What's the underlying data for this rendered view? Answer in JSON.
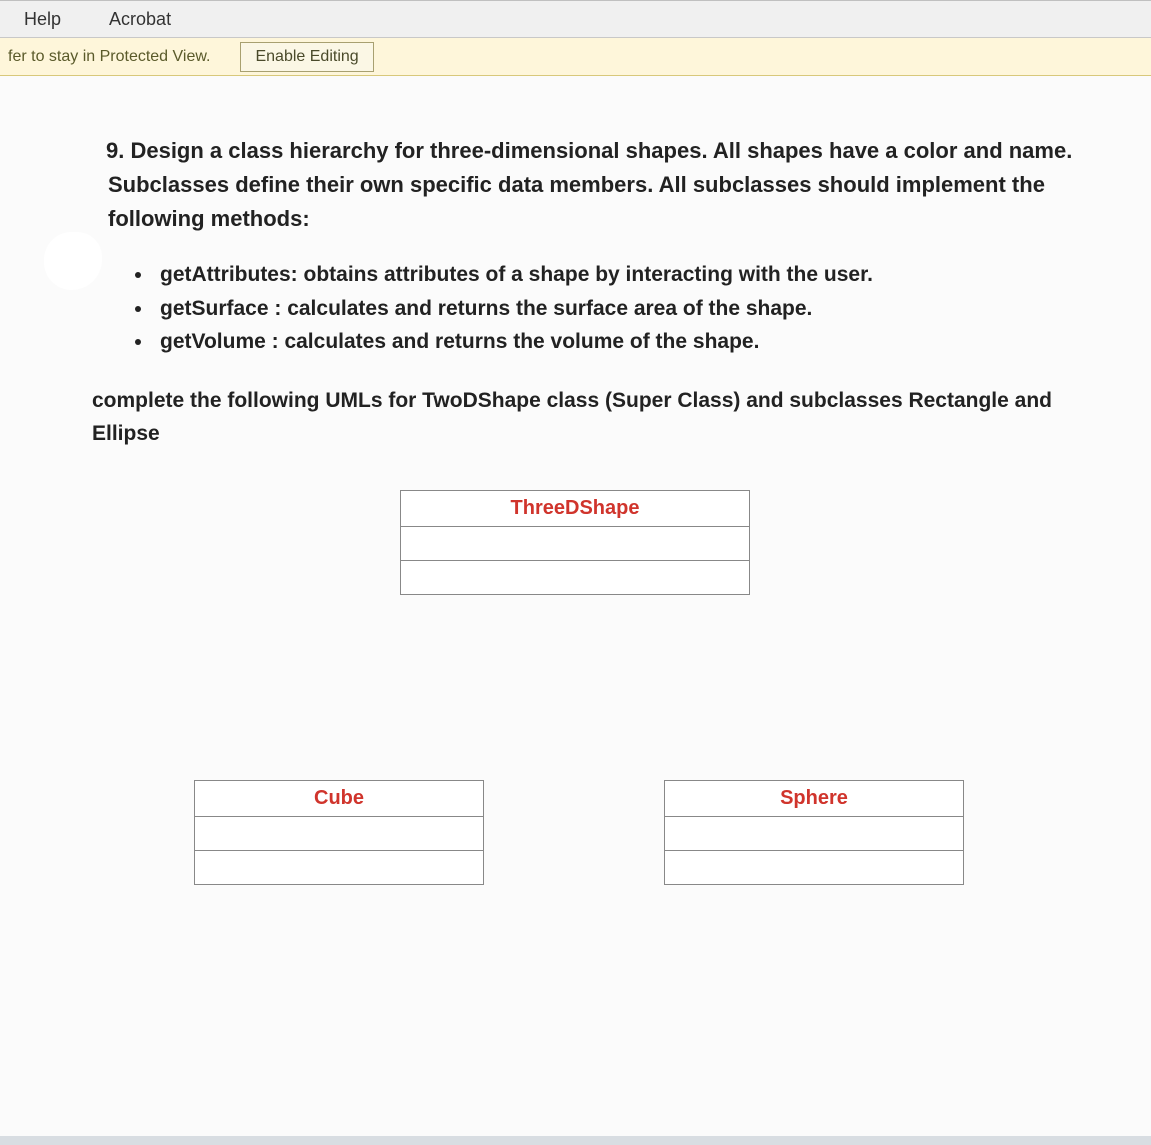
{
  "topbar": {
    "help": "Help",
    "acrobat": "Acrobat"
  },
  "warning": {
    "message": "fer to stay in Protected View.",
    "button": "Enable Editing"
  },
  "question": {
    "number_and_text": "9. Design a class hierarchy for three-dimensional shapes. All shapes have a color and name.  Subclasses define their own specific data members.  All subclasses should implement the following methods:"
  },
  "bullets": [
    "getAttributes: obtains attributes of a shape by interacting with the user.",
    "getSurface    : calculates and returns the surface area of the shape.",
    "getVolume  : calculates and returns the volume of the shape."
  ],
  "complete": "complete the following UMLs for TwoDShape class (Super Class) and subclasses Rectangle and Ellipse",
  "uml": {
    "parent": "ThreeDShape",
    "left": "Cube",
    "right": "Sphere"
  }
}
